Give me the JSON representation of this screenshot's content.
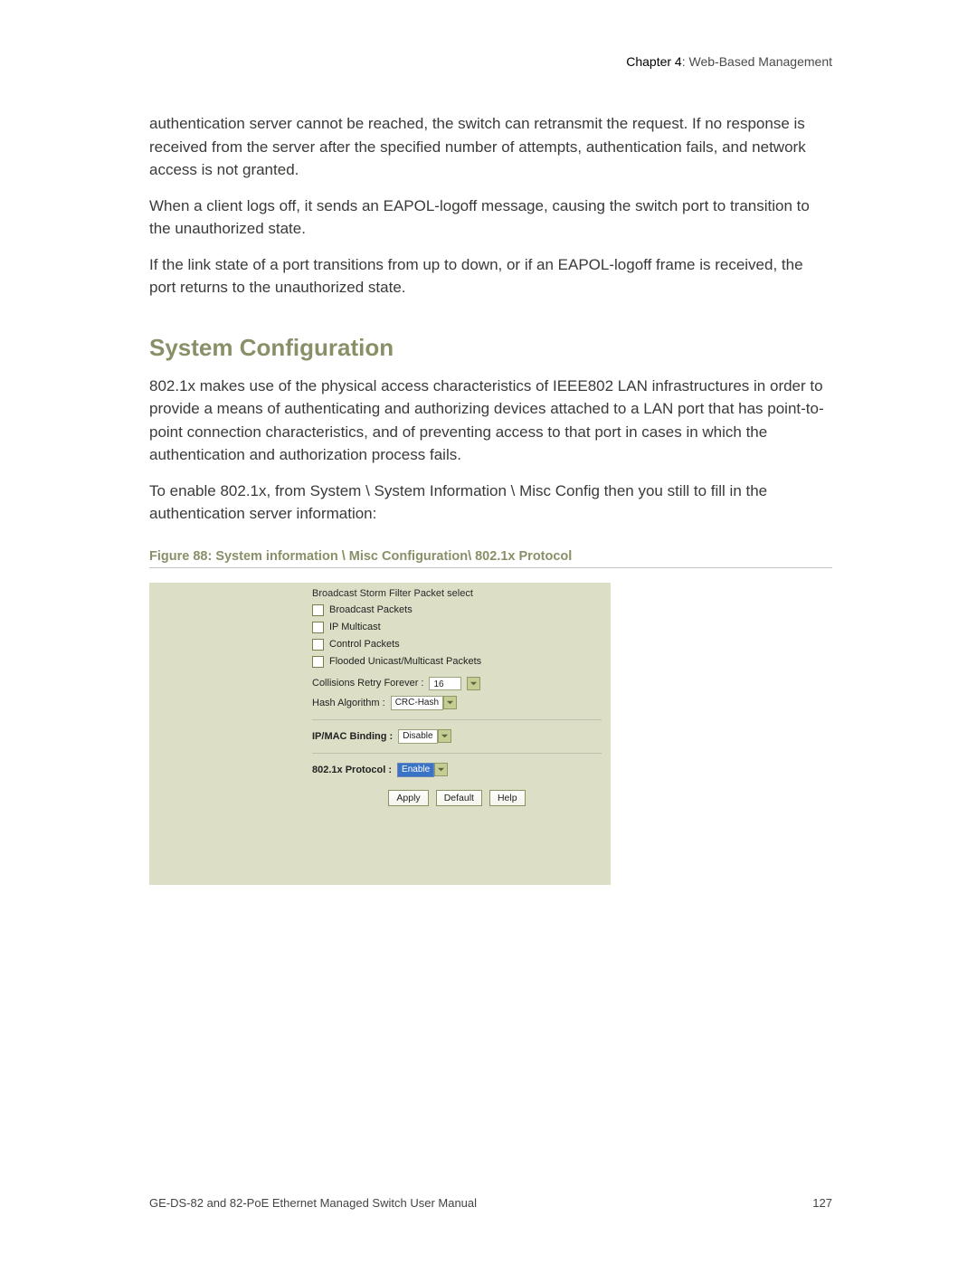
{
  "header": {
    "chapter": "Chapter 4",
    "title": "Web-Based Management"
  },
  "intro": {
    "p1": "authentication server cannot be reached, the switch can retransmit the request. If no response is received from the server after the specified number of attempts, authentication fails, and network access is not granted.",
    "p2": "When a client logs off, it sends an EAPOL-logoff message, causing the switch port to transition to the unauthorized state.",
    "p3": "If the link state of a port transitions from up to down, or if an EAPOL-logoff frame is received, the port returns to the unauthorized state."
  },
  "section": {
    "title": "System Configuration",
    "p1": "802.1x makes use of the physical access characteristics of IEEE802 LAN infrastructures in order to provide a means of authenticating and authorizing devices attached to a LAN port that has point-to-point connection characteristics, and of preventing access to that port in cases in which the authentication and authorization process fails.",
    "p2": "To enable 802.1x, from System \\ System Information \\ Misc Config then you still to fill in the authentication server information:"
  },
  "figure": {
    "caption": "Figure 88: System information \\ Misc Configuration\\ 802.1x Protocol"
  },
  "panel": {
    "heading": "Broadcast Storm Filter Packet select",
    "cbBroadcast": "Broadcast Packets",
    "cbIpMulticast": "IP Multicast",
    "cbControl": "Control Packets",
    "cbFlooded": "Flooded Unicast/Multicast Packets",
    "collisionsLabel": "Collisions Retry Forever :",
    "collisionsValue": "16",
    "hashLabel": "Hash Algorithm :",
    "hashValue": "CRC-Hash",
    "ipmacLabel": "IP/MAC Binding :",
    "ipmacValue": "Disable",
    "dot1xLabel": "802.1x Protocol :",
    "dot1xValue": "Enable",
    "btnApply": "Apply",
    "btnDefault": "Default",
    "btnHelp": "Help"
  },
  "footer": {
    "manual": "GE-DS-82 and 82-PoE Ethernet Managed Switch User Manual",
    "page": "127"
  }
}
